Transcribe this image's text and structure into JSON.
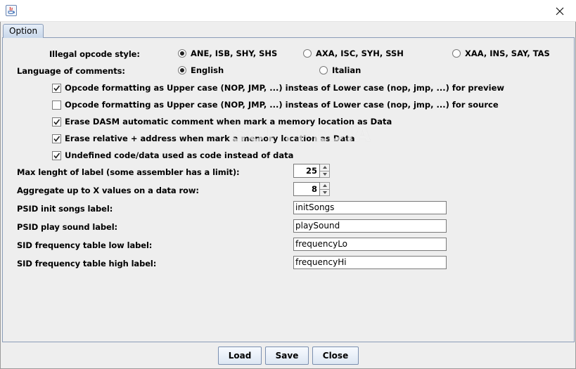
{
  "window": {
    "app_icon": "java-icon",
    "close_icon": "close-icon"
  },
  "tab": {
    "label": "Option"
  },
  "illegal_opcode": {
    "label": "Illegal opcode style:",
    "options": [
      {
        "label": "ANE, ISB, SHY, SHS",
        "selected": true
      },
      {
        "label": "AXA, ISC, SYH, SSH",
        "selected": false
      },
      {
        "label": "XAA, INS, SAY, TAS",
        "selected": false
      }
    ]
  },
  "language": {
    "label": "Language of comments:",
    "options": [
      {
        "label": "English",
        "selected": true
      },
      {
        "label": "Italian",
        "selected": false
      }
    ]
  },
  "checkboxes": [
    {
      "label": "Opcode formatting as Upper case (NOP, JMP, ...) insteas of Lower case (nop, jmp, ...) for preview",
      "checked": true
    },
    {
      "label": "Opcode formatting as Upper case (NOP, JMP, ...) insteas of Lower case (nop, jmp, ...) for source",
      "checked": false
    },
    {
      "label": "Erase DASM automatic comment when mark a memory location as Data",
      "checked": true
    },
    {
      "label": "Erase relative + address when mark a memory location as Data",
      "checked": true
    },
    {
      "label": "Undefined code/data used as code instead of data",
      "checked": true
    }
  ],
  "spinners": [
    {
      "label": "Max lenght of label (some assembler has a limit):",
      "value": "25"
    },
    {
      "label": "Aggregate up to X values on a data row:",
      "value": "8"
    }
  ],
  "fields": [
    {
      "label": "PSID init songs label:",
      "value": "initSongs"
    },
    {
      "label": "PSID play sound label:",
      "value": "playSound"
    },
    {
      "label": "SID frequency table low label:",
      "value": "frequencyLo"
    },
    {
      "label": "SID frequency table high label:",
      "value": "frequencyHi"
    }
  ],
  "buttons": {
    "load": "Load",
    "save": "Save",
    "close": "Close"
  },
  "watermark": "SOFTPEDIA"
}
